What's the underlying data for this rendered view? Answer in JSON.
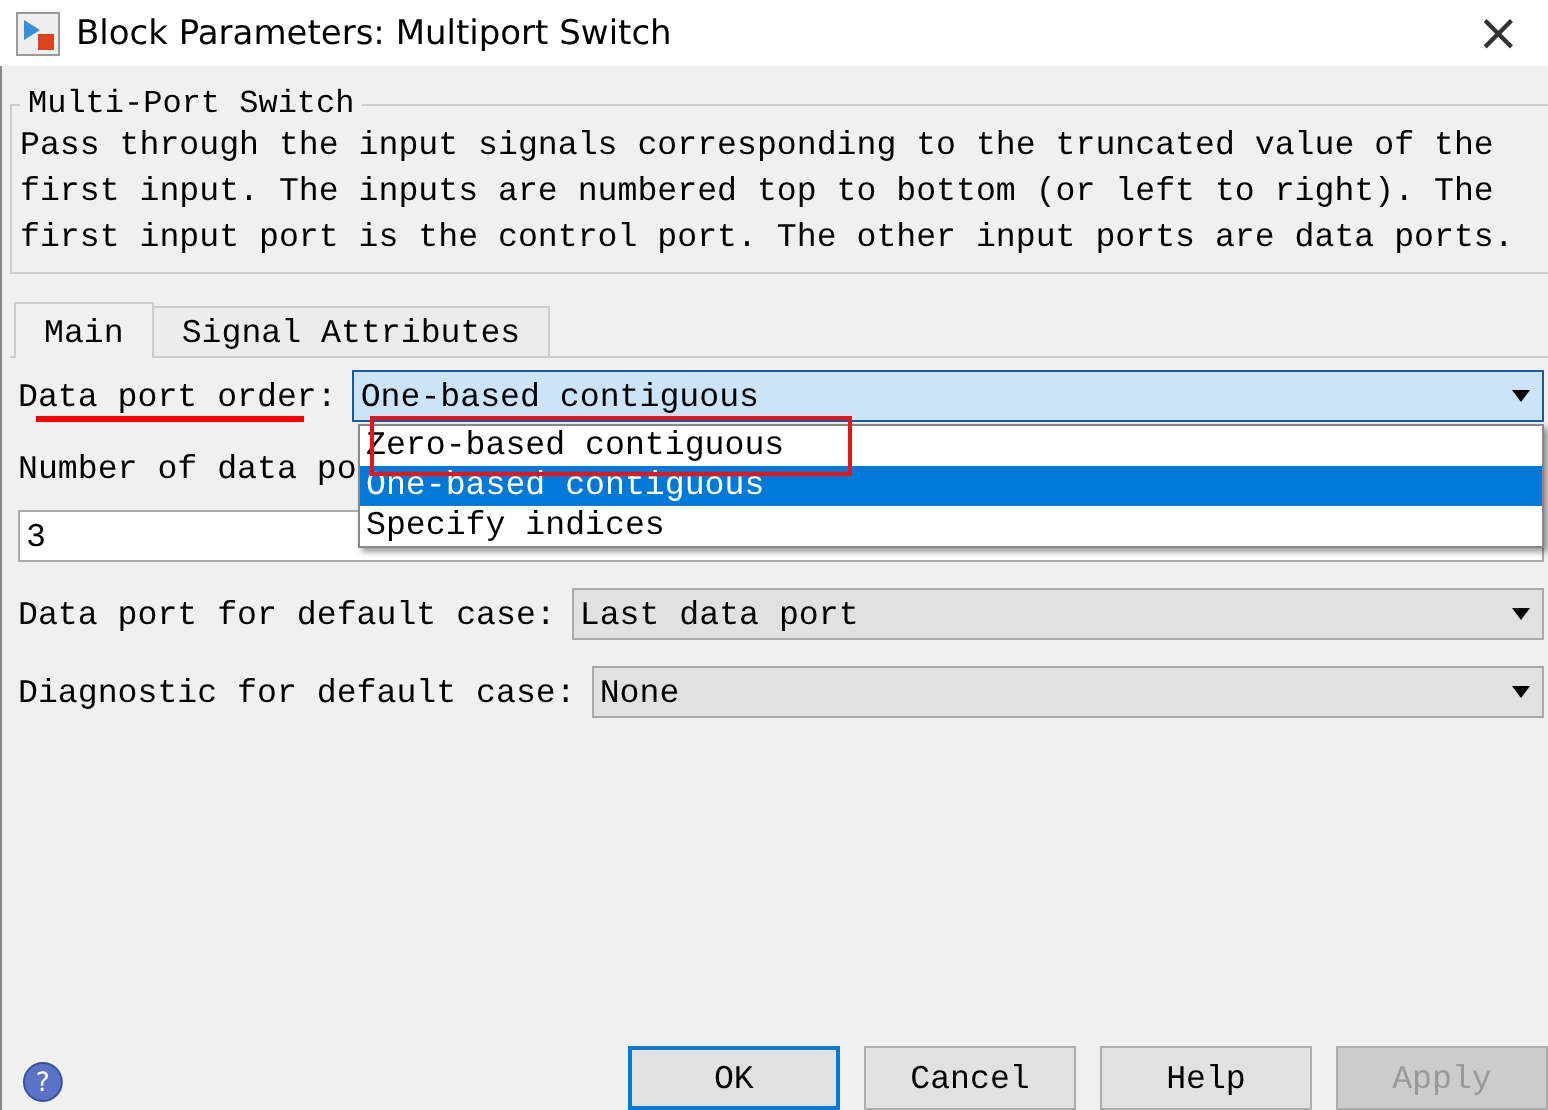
{
  "window": {
    "title": "Block Parameters: Multiport Switch",
    "close": "×"
  },
  "group": {
    "title": "Multi-Port Switch",
    "description": "Pass through the input signals corresponding to the truncated value of the first input. The inputs are numbered top to bottom (or left to right). The first input port is the control port. The other input ports are data ports."
  },
  "tabs": [
    {
      "label": "Main",
      "selected": true
    },
    {
      "label": "Signal Attributes",
      "selected": false
    }
  ],
  "data_port_order": {
    "label": "Data port order:",
    "value": "One-based contiguous",
    "expanded": true,
    "options": [
      {
        "label": "Zero-based contiguous",
        "selected": false
      },
      {
        "label": "One-based contiguous",
        "selected": true
      },
      {
        "label": "Specify indices",
        "selected": false
      }
    ]
  },
  "number_of_ports": {
    "label": "Number of data po",
    "value": "3"
  },
  "default_case_port": {
    "label": "Data port for default case:",
    "value": "Last data port"
  },
  "diagnostic": {
    "label": "Diagnostic for default case:",
    "value": "None"
  },
  "help": "?",
  "buttons": [
    {
      "label": "OK",
      "focused": true,
      "disabled": false
    },
    {
      "label": "Cancel",
      "focused": false,
      "disabled": false
    },
    {
      "label": "Help",
      "focused": false,
      "disabled": false
    },
    {
      "label": "Apply",
      "focused": false,
      "disabled": true
    }
  ]
}
